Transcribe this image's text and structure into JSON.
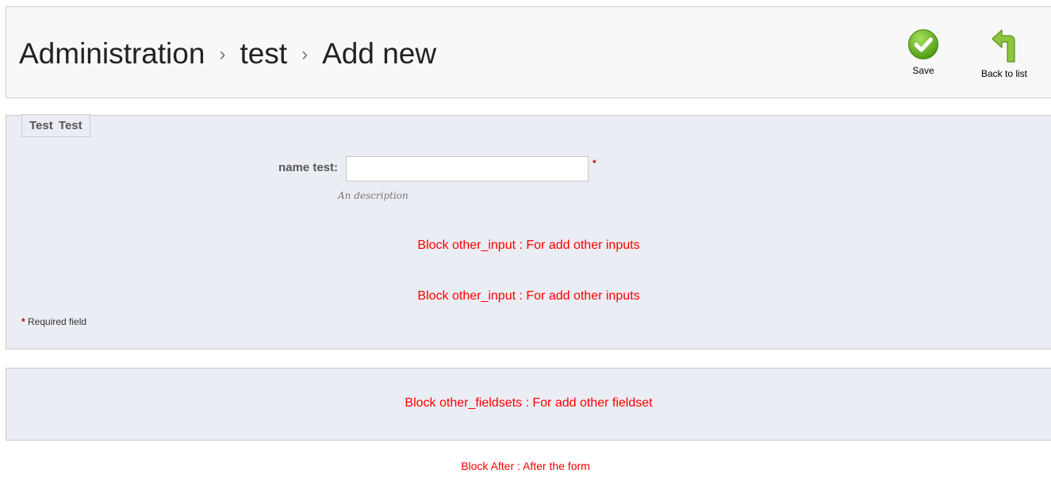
{
  "toolbar": {
    "breadcrumb": [
      "Administration",
      "test",
      "Add new"
    ],
    "separator": "›",
    "save_label": "Save",
    "back_label": "Back to list"
  },
  "form": {
    "legend": "Test  Test",
    "field_label": "name test:",
    "field_value": "",
    "required_marker": "*",
    "field_description": "An description",
    "block_other_input_1": "Block other_input : For add other inputs",
    "block_other_input_2": "Block other_input : For add other inputs",
    "required_note": "Required field"
  },
  "fieldsets": {
    "block_other_fieldsets": "Block other_fieldsets : For add other fieldset"
  },
  "after": {
    "block_after": "Block After : After the form"
  },
  "icons": {
    "save": "check-circle-icon",
    "back": "back-arrow-icon"
  },
  "colors": {
    "save_green": "#6cb520",
    "back_green": "#8cc63f",
    "notice_red": "#ff0000",
    "panel_bg": "#ebedf4"
  }
}
